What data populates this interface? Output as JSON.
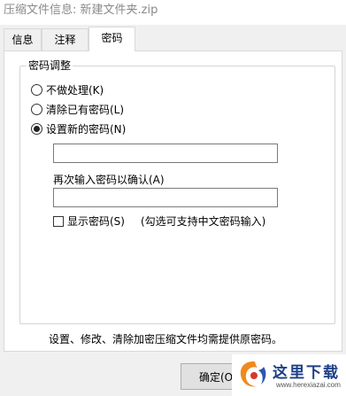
{
  "window": {
    "title": "压缩文件信息: 新建文件夹.zip"
  },
  "tabs": [
    {
      "label": "信息",
      "active": false
    },
    {
      "label": "注释",
      "active": false
    },
    {
      "label": "密码",
      "active": true
    }
  ],
  "password_group": {
    "title": "密码调整",
    "options": [
      {
        "label": "不做处理(K)",
        "checked": false
      },
      {
        "label": "清除已有密码(L)",
        "checked": false
      },
      {
        "label": "设置新的密码(N)",
        "checked": true
      }
    ],
    "password_input": {
      "value": ""
    },
    "confirm_label": "再次输入密码以确认(A)",
    "confirm_input": {
      "value": ""
    },
    "show_password": {
      "label": "显示密码(S)",
      "checked": false
    },
    "hint": "(勾选可支持中文密码输入)"
  },
  "footer_note": "设置、修改、清除加密压缩文件均需提供原密码。",
  "buttons": {
    "ok_label": "确定(O"
  },
  "watermark": {
    "text": "这里下载",
    "url": "www.herexiazai.com"
  },
  "colors": {
    "accent": "#1d3f86",
    "window_bg": "#f0f0f0",
    "panel_bg": "#ffffff"
  }
}
